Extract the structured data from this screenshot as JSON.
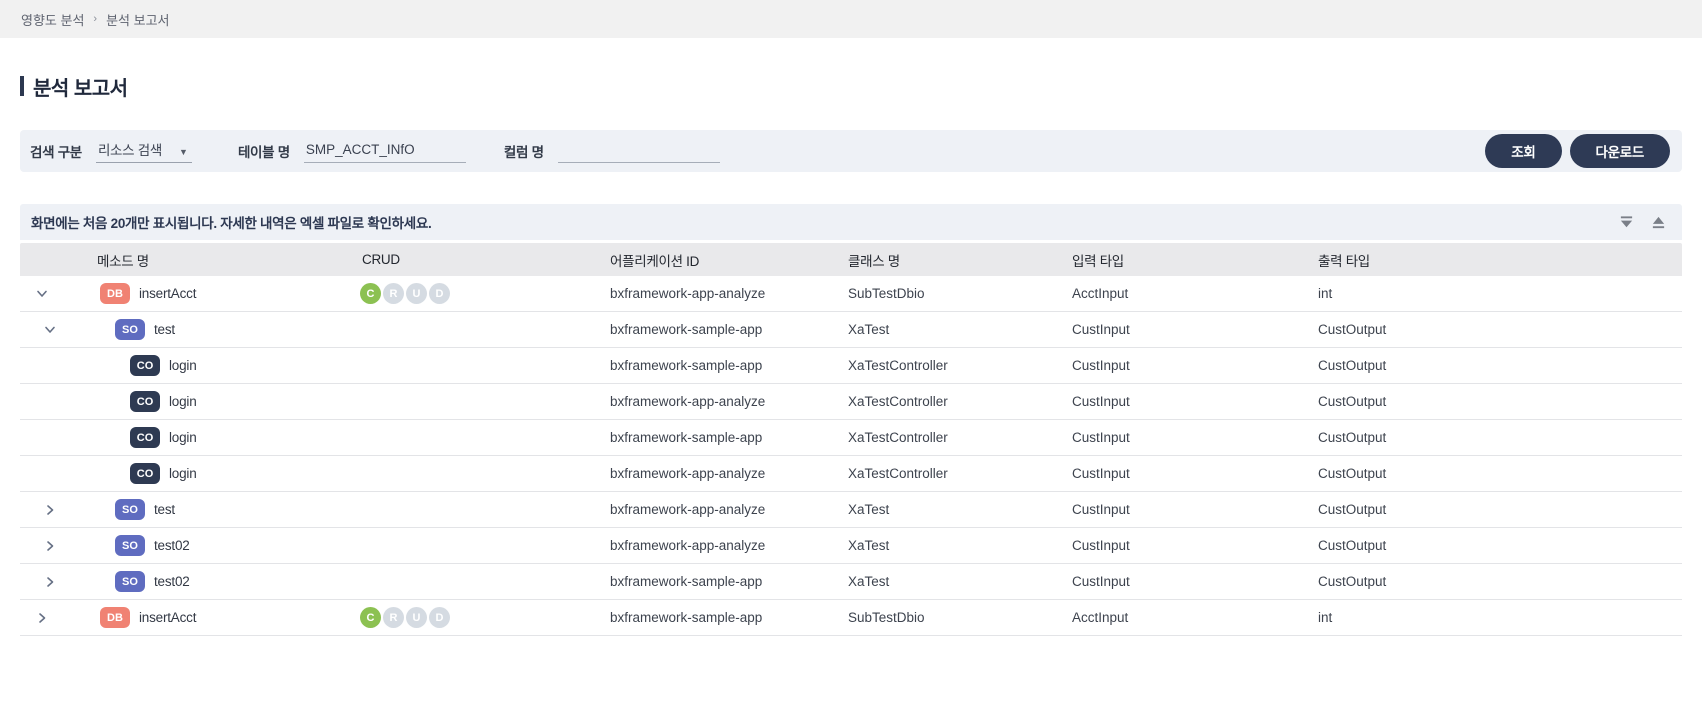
{
  "breadcrumb": {
    "items": [
      "영향도 분석",
      "분석 보고서"
    ],
    "separator": "›"
  },
  "page": {
    "title": "분석 보고서"
  },
  "search": {
    "type_label": "검색 구분",
    "type_value": "리소스 검색",
    "table_label": "테이블 명",
    "table_value": "SMP_ACCT_INfO",
    "column_label": "컬럼 명",
    "column_value": "",
    "search_button": "조회",
    "download_button": "다운로드"
  },
  "notice": {
    "text": "화면에는 처음 20개만 표시됩니다. 자세한 내역은 엑셀 파일로 확인하세요.",
    "icons": [
      "collapse-all-icon",
      "export-top-icon"
    ]
  },
  "table": {
    "columns": [
      "메소드 명",
      "CRUD",
      "어플리케이션 ID",
      "클래스 명",
      "입력 타입",
      "출력 타입"
    ],
    "crud_letters": [
      "C",
      "R",
      "U",
      "D"
    ],
    "rows": [
      {
        "level": 0,
        "chevron": "down",
        "badge": "DB",
        "method": "insertAcct",
        "has_crud": true,
        "crud_active": [
          "C"
        ],
        "app": "bxframework-app-analyze",
        "class": "SubTestDbio",
        "input": "AcctInput",
        "output": "int"
      },
      {
        "level": 1,
        "chevron": "down",
        "badge": "SO",
        "method": "test",
        "has_crud": false,
        "crud_active": [],
        "app": "bxframework-sample-app",
        "class": "XaTest",
        "input": "CustInput",
        "output": "CustOutput"
      },
      {
        "level": 2,
        "chevron": null,
        "badge": "CO",
        "method": "login",
        "has_crud": false,
        "crud_active": [],
        "app": "bxframework-sample-app",
        "class": "XaTestController",
        "input": "CustInput",
        "output": "CustOutput"
      },
      {
        "level": 2,
        "chevron": null,
        "badge": "CO",
        "method": "login",
        "has_crud": false,
        "crud_active": [],
        "app": "bxframework-app-analyze",
        "class": "XaTestController",
        "input": "CustInput",
        "output": "CustOutput"
      },
      {
        "level": 2,
        "chevron": null,
        "badge": "CO",
        "method": "login",
        "has_crud": false,
        "crud_active": [],
        "app": "bxframework-sample-app",
        "class": "XaTestController",
        "input": "CustInput",
        "output": "CustOutput"
      },
      {
        "level": 2,
        "chevron": null,
        "badge": "CO",
        "method": "login",
        "has_crud": false,
        "crud_active": [],
        "app": "bxframework-app-analyze",
        "class": "XaTestController",
        "input": "CustInput",
        "output": "CustOutput"
      },
      {
        "level": 1,
        "chevron": "right",
        "badge": "SO",
        "method": "test",
        "has_crud": false,
        "crud_active": [],
        "app": "bxframework-app-analyze",
        "class": "XaTest",
        "input": "CustInput",
        "output": "CustOutput"
      },
      {
        "level": 1,
        "chevron": "right",
        "badge": "SO",
        "method": "test02",
        "has_crud": false,
        "crud_active": [],
        "app": "bxframework-app-analyze",
        "class": "XaTest",
        "input": "CustInput",
        "output": "CustOutput"
      },
      {
        "level": 1,
        "chevron": "right",
        "badge": "SO",
        "method": "test02",
        "has_crud": false,
        "crud_active": [],
        "app": "bxframework-sample-app",
        "class": "XaTest",
        "input": "CustInput",
        "output": "CustOutput"
      },
      {
        "level": 0,
        "chevron": "right",
        "badge": "DB",
        "method": "insertAcct",
        "has_crud": true,
        "crud_active": [
          "C"
        ],
        "app": "bxframework-sample-app",
        "class": "SubTestDbio",
        "input": "AcctInput",
        "output": "int"
      }
    ]
  },
  "colors": {
    "accent": "#2e3a55",
    "panel_bg": "#eef1f6",
    "db_badge": "#f08273",
    "so_badge": "#5f6cc0",
    "co_badge": "#2e3a52",
    "crud_active": "#8cc152",
    "crud_inactive": "#d5dbe2"
  }
}
